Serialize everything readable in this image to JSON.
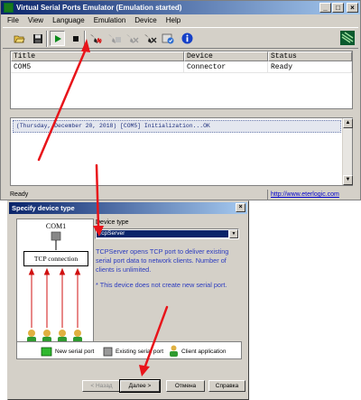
{
  "window": {
    "title": "Virtual Serial Ports Emulator (Emulation started)",
    "minimize": "_",
    "maximize": "□",
    "close": "×"
  },
  "menu": [
    "File",
    "View",
    "Language",
    "Emulation",
    "Device",
    "Help"
  ],
  "toolbar": {
    "icons": [
      "open-icon",
      "save-icon",
      "start-icon",
      "stop-icon",
      "new-device-icon",
      "edit-device-icon",
      "delete-device-icon",
      "disabled-device-icon",
      "device-properties-icon",
      "about-icon"
    ]
  },
  "device_table": {
    "headers": [
      "Title",
      "Device",
      "Status"
    ],
    "rows": [
      [
        "COM5",
        "Connector",
        "Ready"
      ]
    ]
  },
  "log": {
    "lines": [
      "(Thursday, December 20, 2018) [COM5] Initialization...OK"
    ]
  },
  "statusbar": {
    "text": "Ready",
    "link": "http://www.eterlogic.com"
  },
  "dialog": {
    "title": "Specify device type",
    "close": "×",
    "diagram_port": "COM1",
    "diagram_box": "TCP connection",
    "device_type_label": "Device type",
    "device_type_value": "TcpServer",
    "description": "TCPServer opens TCP port to deliver existing serial port data to network clients. Number of clients is unlimited.",
    "note": "* This device does not create new serial port.",
    "legend": [
      "New serial port",
      "Existing serial port",
      "Client application"
    ],
    "buttons": {
      "back": "< Назад",
      "next": "Далее >",
      "cancel": "Отмена",
      "help": "Справка"
    }
  },
  "colors": {
    "titlebar_start": "#0a246a",
    "titlebar_end": "#a6caf0",
    "desc_text": "#2b3bbf",
    "annotation_arrow": "#e8141a"
  }
}
